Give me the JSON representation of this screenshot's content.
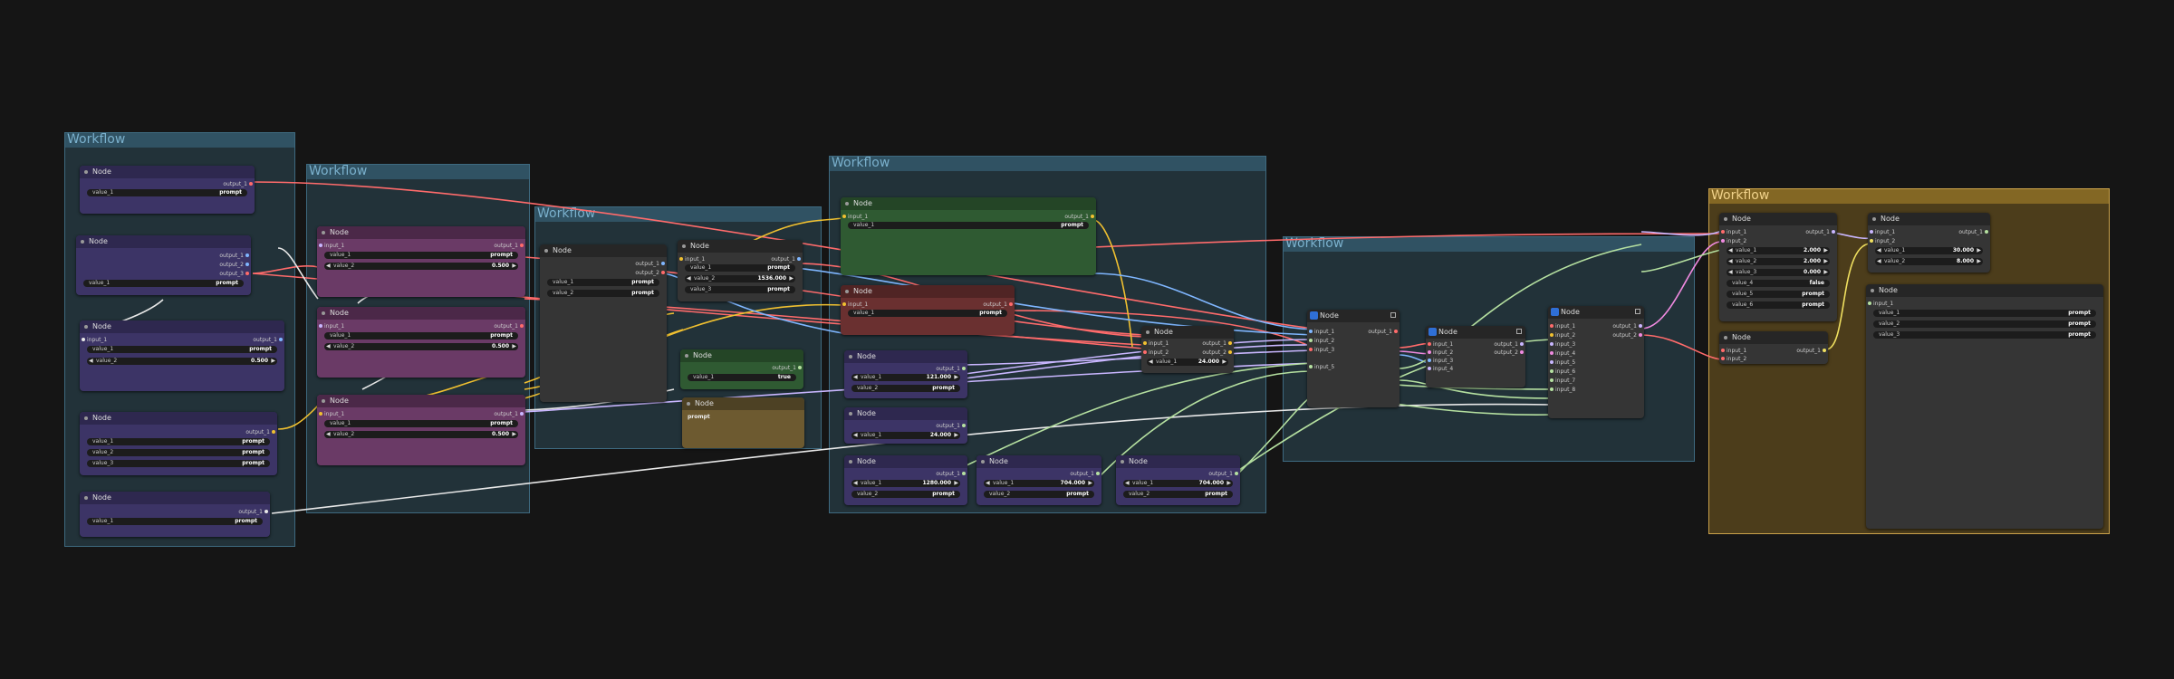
{
  "groups": {
    "title": "Workflow"
  },
  "node_title": "Node",
  "labels": {
    "input_1": "input_1",
    "input_2": "input_2",
    "input_3": "input_3",
    "input_4": "input_4",
    "input_5": "input_5",
    "input_6": "input_6",
    "input_7": "input_7",
    "input_8": "input_8",
    "output_1": "output_1",
    "output_2": "output_2",
    "output_3": "output_3",
    "value_1": "value_1",
    "value_2": "value_2",
    "value_3": "value_3",
    "value_4": "value_4",
    "value_5": "value_5",
    "value_6": "value_6"
  },
  "values": {
    "prompt": "prompt",
    "v0500": "0.500",
    "v1536": "1536.000",
    "v121": "121.000",
    "v24": "24.000",
    "v1280": "1280.000",
    "v704": "704.000",
    "v2000": "2.000",
    "v0000": "0.000",
    "vfalse": "false",
    "v30": "30.000",
    "v8": "8.000",
    "vtrue": "true"
  },
  "colors": {
    "canvas": "#151515",
    "group_blue": "#345a6c",
    "group_gold": "#6e561e",
    "link_red": "#ff6b6b",
    "link_yellow": "#f0c030",
    "link_blue": "#7fb6ff",
    "link_pink": "#f08ae0",
    "link_lavender": "#c9b6ff",
    "link_green": "#b5e0a0",
    "link_white": "#e8e8e8"
  },
  "icons": [
    "slot-dot-icon",
    "node-status-dot-icon",
    "decrement-arrow-icon",
    "increment-arrow-icon",
    "node-type-icon",
    "collapse-checkbox-icon",
    "toggle-icon"
  ]
}
